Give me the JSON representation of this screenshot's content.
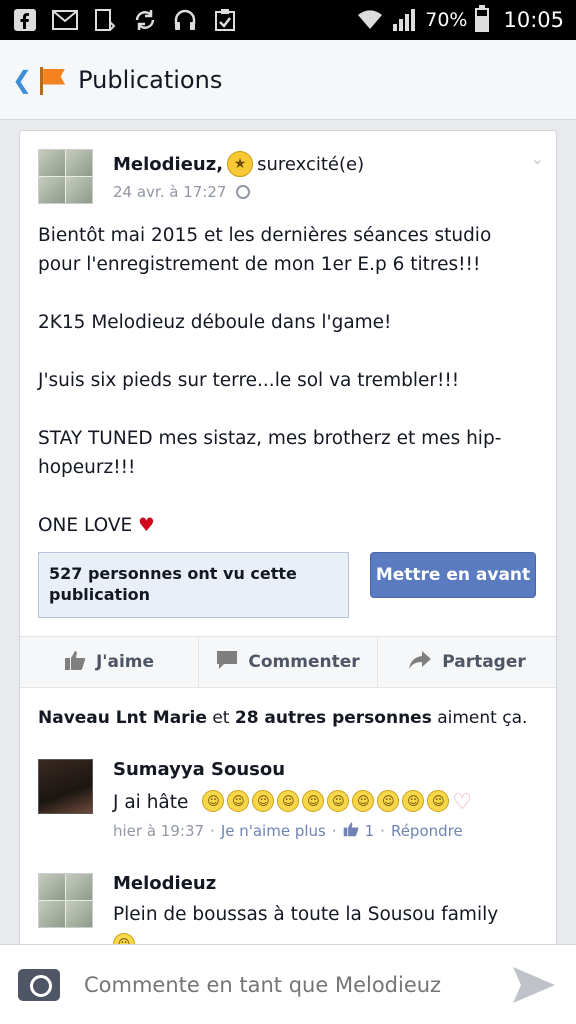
{
  "status_bar": {
    "battery": "70%",
    "time": "10:05",
    "icons": [
      "facebook-icon",
      "mail-icon",
      "download-icon",
      "sync-icon",
      "headphones-icon",
      "clipboard-icon",
      "wifi-icon",
      "signal-icon",
      "battery-icon"
    ]
  },
  "header": {
    "title": "Publications"
  },
  "post": {
    "author": "Melodieuz,",
    "feeling": "surexcité(e)",
    "date": "24 avr. à 17:27",
    "body": [
      "Bientôt mai 2015 et les dernières séances studio pour l'enregistrement de mon 1er E.p 6 titres!!!",
      "2K15 Melodieuz déboule dans l'game!",
      "J'suis six pieds sur terre...le sol va trembler!!!",
      "STAY TUNED mes sistaz, mes brotherz et mes hip-hopeurz!!!",
      "ONE LOVE"
    ],
    "views": "527 personnes ont vu cette publication",
    "boost_label": "Mettre en avant"
  },
  "actions": {
    "like": "J'aime",
    "comment": "Commenter",
    "share": "Partager"
  },
  "likes": {
    "first": "Naveau Lnt Marie",
    "and": "et",
    "others": "28 autres personnes",
    "suffix": "aiment ça."
  },
  "comments": [
    {
      "name": "Sumayya Sousou",
      "text": "J ai hâte",
      "time": "hier à 19:37",
      "unlike": "Je n'aime plus",
      "like_count": "1",
      "reply": "Répondre"
    },
    {
      "name": "Melodieuz",
      "text": "Plein de boussas à toute la Sousou family"
    }
  ],
  "compose": {
    "placeholder": "Commente en tant que Melodieuz"
  },
  "colors": {
    "accent": "#5b7bc0",
    "link": "#6d84b4",
    "meta": "#9197a3"
  }
}
